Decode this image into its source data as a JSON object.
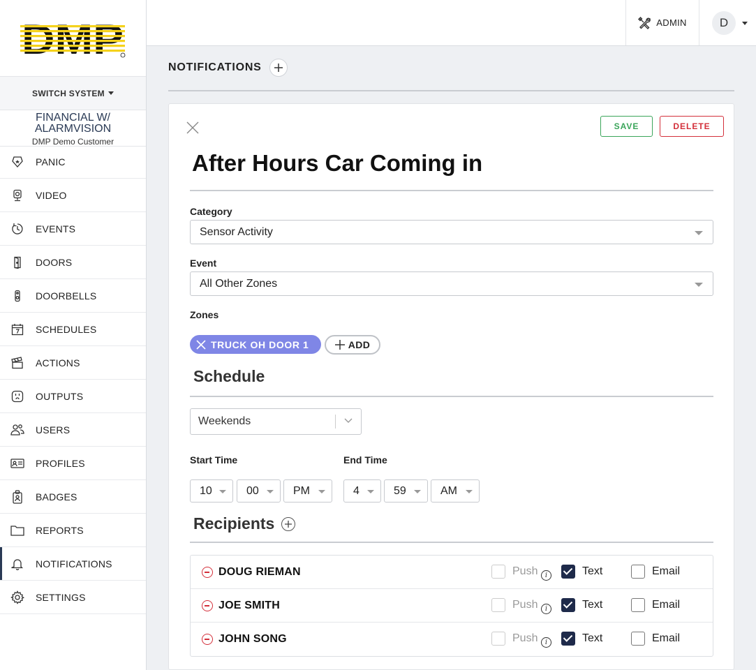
{
  "brand": {
    "logo_text": "DMP"
  },
  "sidebar": {
    "switch_label": "SWITCH SYSTEM",
    "site_name": "FINANCIAL W/ ALARMVISION",
    "customer": "DMP Demo Customer",
    "items": [
      {
        "label": "PANIC",
        "icon": "panic-icon"
      },
      {
        "label": "VIDEO",
        "icon": "video-icon"
      },
      {
        "label": "EVENTS",
        "icon": "events-icon"
      },
      {
        "label": "DOORS",
        "icon": "door-icon"
      },
      {
        "label": "DOORBELLS",
        "icon": "doorbell-icon"
      },
      {
        "label": "SCHEDULES",
        "icon": "calendar-icon"
      },
      {
        "label": "ACTIONS",
        "icon": "clapper-icon"
      },
      {
        "label": "OUTPUTS",
        "icon": "outlet-icon"
      },
      {
        "label": "USERS",
        "icon": "users-icon"
      },
      {
        "label": "PROFILES",
        "icon": "id-card-icon"
      },
      {
        "label": "BADGES",
        "icon": "badge-icon"
      },
      {
        "label": "REPORTS",
        "icon": "folder-icon"
      },
      {
        "label": "NOTIFICATIONS",
        "icon": "bell-icon",
        "active": true
      },
      {
        "label": "SETTINGS",
        "icon": "gear-icon"
      }
    ]
  },
  "topbar": {
    "admin_label": "ADMIN",
    "avatar_initial": "D"
  },
  "page": {
    "title": "NOTIFICATIONS"
  },
  "form": {
    "save_label": "SAVE",
    "delete_label": "DELETE",
    "title": "After Hours Car Coming in",
    "category_label": "Category",
    "category_value": "Sensor Activity",
    "event_label": "Event",
    "event_value": "All Other Zones",
    "zones_label": "Zones",
    "zone_chip": "TRUCK OH DOOR 1",
    "add_label": "ADD",
    "schedule_heading": "Schedule",
    "schedule_value": "Weekends",
    "start_label": "Start Time",
    "end_label": "End Time",
    "start": {
      "hour": "10",
      "minute": "00",
      "ampm": "PM"
    },
    "end": {
      "hour": "4",
      "minute": "59",
      "ampm": "AM"
    },
    "recipients_heading": "Recipients",
    "push_label": "Push",
    "text_label": "Text",
    "email_label": "Email",
    "recipients": [
      {
        "name": "DOUG RIEMAN",
        "push": false,
        "text": true,
        "email": false
      },
      {
        "name": "JOE SMITH",
        "push": false,
        "text": true,
        "email": false
      },
      {
        "name": "JOHN SONG",
        "push": false,
        "text": true,
        "email": false
      }
    ]
  },
  "colors": {
    "accent_navy": "#1e2a4a",
    "chip": "#7f86e6",
    "save": "#3aa55a",
    "delete": "#d32f3a",
    "logo_yellow": "#f5d21c"
  }
}
